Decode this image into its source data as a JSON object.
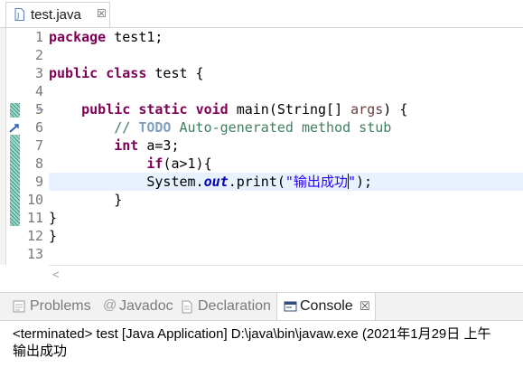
{
  "editor_tab": {
    "file_name": "test.java",
    "close_glyph": "☒"
  },
  "line_numbers": [
    "1",
    "2",
    "3",
    "4",
    "5",
    "6",
    "7",
    "8",
    "9",
    "10",
    "11",
    "12",
    "13"
  ],
  "code": {
    "l1_kw": "package",
    "l1_rest": " test1;",
    "l3_kw1": "public",
    "l3_sp1": " ",
    "l3_kw2": "class",
    "l3_rest": " test {",
    "l5_indent": "    ",
    "l5_kw1": "public",
    "l5_kw2": "static",
    "l5_kw3": "void",
    "l5_mid": " main(String[] ",
    "l5_param": "args",
    "l5_end": ") {",
    "l6_indent": "        ",
    "l6_slash": "// ",
    "l6_todo": "TODO",
    "l6_rest": " Auto-generated method stub",
    "l7_indent": "        ",
    "l7_kw": "int",
    "l7_rest": " a=3;",
    "l8_indent": "            ",
    "l8_kw": "if",
    "l8_rest": "(a>1){",
    "l9_indent": "            ",
    "l9_obj": "System.",
    "l9_field": "out",
    "l9_call": ".print(",
    "l9_str_a": "\"输出成功",
    "l9_str_b": "\"",
    "l9_end": ");",
    "l10_text": "        }",
    "l11_text": "}",
    "l12_text": "}"
  },
  "views": {
    "problems": "Problems",
    "javadoc": "Javadoc",
    "declaration": "Declaration",
    "console": "Console",
    "console_close": "☒"
  },
  "console": {
    "status": "<terminated> test [Java Application] D:\\java\\bin\\javaw.exe (2021年1月29日 上午",
    "output": "输出成功"
  },
  "colors": {
    "keyword": "#7f0055",
    "comment": "#3f7f5f",
    "string": "#2a00ff",
    "field": "#0000c0",
    "current_line": "#e8f2fe"
  }
}
